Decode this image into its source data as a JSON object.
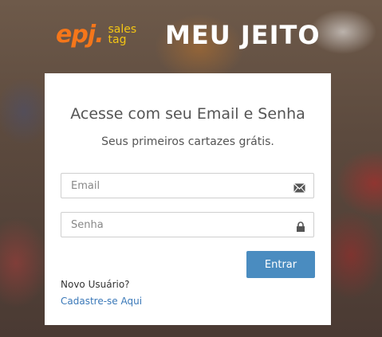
{
  "brand": {
    "logo_main": "epj.",
    "logo_sub_top": "sales",
    "logo_sub_bottom": "tag",
    "product": "MEU JEITO"
  },
  "login": {
    "title": "Acesse com seu Email e Senha",
    "subtitle": "Seus primeiros cartazes grátis.",
    "email_placeholder": "Email",
    "password_placeholder": "Senha",
    "submit_label": "Entrar",
    "new_user_text": "Novo Usuário?",
    "signup_link": "Cadastre-se Aqui"
  },
  "icons": {
    "email": "envelope-icon",
    "password": "lock-icon"
  },
  "colors": {
    "accent_button": "#4a8cc0",
    "link": "#3a78b8",
    "logo_orange": "#f5761a",
    "logo_yellow": "#f3c514"
  }
}
